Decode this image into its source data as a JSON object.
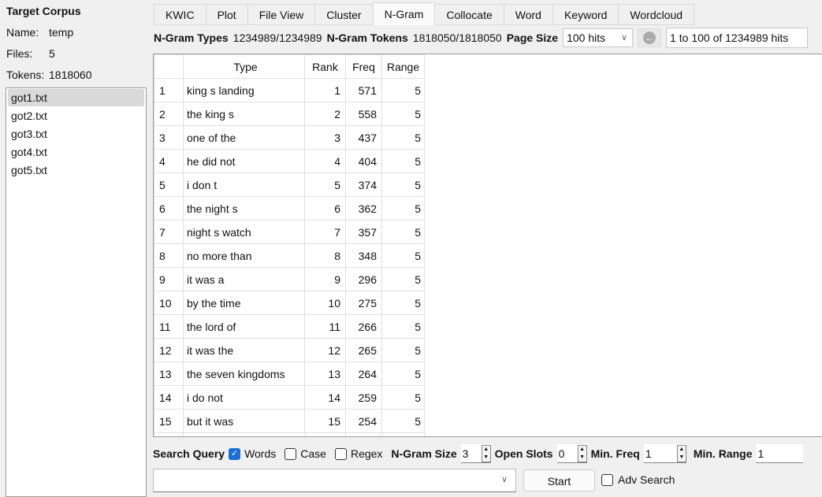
{
  "sidebar": {
    "title": "Target Corpus",
    "name_label": "Name:",
    "name": "temp",
    "files_label": "Files:",
    "files": "5",
    "tokens_label": "Tokens:",
    "tokens": "1818060",
    "file_list": [
      "got1.txt",
      "got2.txt",
      "got3.txt",
      "got4.txt",
      "got5.txt"
    ]
  },
  "tabs": [
    "KWIC",
    "Plot",
    "File View",
    "Cluster",
    "N-Gram",
    "Collocate",
    "Word",
    "Keyword",
    "Wordcloud"
  ],
  "active_tab": "N-Gram",
  "info": {
    "types_label": "N-Gram Types",
    "types": "1234989/1234989",
    "tokens_label": "N-Gram Tokens",
    "tokens": "1818050/1818050",
    "page_size_label": "Page Size",
    "page_size": "100 hits",
    "page_range": "1 to 100 of 1234989 hits"
  },
  "table": {
    "headers": [
      "",
      "Type",
      "Rank",
      "Freq",
      "Range"
    ],
    "rows": [
      [
        "1",
        "king s landing",
        "1",
        "571",
        "5"
      ],
      [
        "2",
        "the king s",
        "2",
        "558",
        "5"
      ],
      [
        "3",
        "one of the",
        "3",
        "437",
        "5"
      ],
      [
        "4",
        "he did not",
        "4",
        "404",
        "5"
      ],
      [
        "5",
        "i don t",
        "5",
        "374",
        "5"
      ],
      [
        "6",
        "the night s",
        "6",
        "362",
        "5"
      ],
      [
        "7",
        "night s watch",
        "7",
        "357",
        "5"
      ],
      [
        "8",
        "no more than",
        "8",
        "348",
        "5"
      ],
      [
        "9",
        "it was a",
        "9",
        "296",
        "5"
      ],
      [
        "10",
        "by the time",
        "10",
        "275",
        "5"
      ],
      [
        "11",
        "the lord of",
        "11",
        "266",
        "5"
      ],
      [
        "12",
        "it was the",
        "12",
        "265",
        "5"
      ],
      [
        "13",
        "the seven kingdoms",
        "13",
        "264",
        "5"
      ],
      [
        "14",
        "i do not",
        "14",
        "259",
        "5"
      ],
      [
        "15",
        "but it was",
        "15",
        "254",
        "5"
      ]
    ]
  },
  "query": {
    "label": "Search Query",
    "words": "Words",
    "words_checked": true,
    "case": "Case",
    "case_checked": false,
    "regex": "Regex",
    "regex_checked": false,
    "ngram_size_label": "N-Gram Size",
    "ngram_size": "3",
    "open_slots_label": "Open Slots",
    "open_slots": "0",
    "min_freq_label": "Min. Freq",
    "min_freq": "1",
    "min_range_label": "Min. Range",
    "min_range": "1",
    "search_value": "",
    "start": "Start",
    "adv_search": "Adv Search",
    "adv_checked": false
  }
}
